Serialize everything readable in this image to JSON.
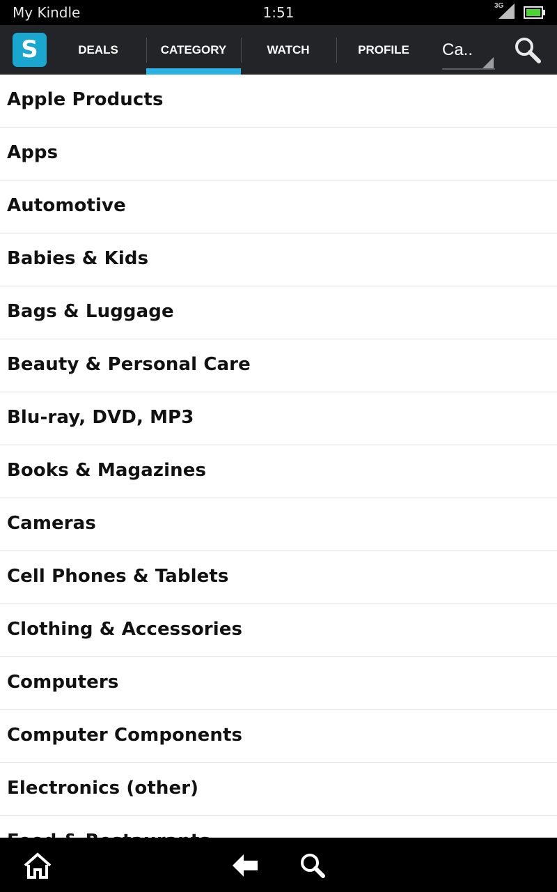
{
  "status": {
    "device_name": "My Kindle",
    "time": "1:51",
    "network": "3G"
  },
  "action_bar": {
    "logo_letter": "S",
    "tabs": [
      {
        "label": "DEALS"
      },
      {
        "label": "CATEGORY"
      },
      {
        "label": "WATCH"
      },
      {
        "label": "PROFILE"
      }
    ],
    "active_tab": "CATEGORY",
    "spinner_value": "Ca..",
    "accent_color": "#2ab2e5",
    "logo_color": "#19a6cf"
  },
  "categories": [
    {
      "label": "Apple Products"
    },
    {
      "label": "Apps"
    },
    {
      "label": "Automotive"
    },
    {
      "label": "Babies & Kids"
    },
    {
      "label": "Bags & Luggage"
    },
    {
      "label": "Beauty & Personal Care"
    },
    {
      "label": "Blu-ray, DVD, MP3"
    },
    {
      "label": "Books & Magazines"
    },
    {
      "label": "Cameras"
    },
    {
      "label": "Cell Phones & Tablets"
    },
    {
      "label": "Clothing & Accessories"
    },
    {
      "label": "Computers"
    },
    {
      "label": "Computer Components"
    },
    {
      "label": "Electronics (other)"
    },
    {
      "label": "Food & Restaurants"
    }
  ],
  "bottom_nav": {
    "icons": [
      "home-icon",
      "back-icon",
      "search-icon"
    ]
  }
}
